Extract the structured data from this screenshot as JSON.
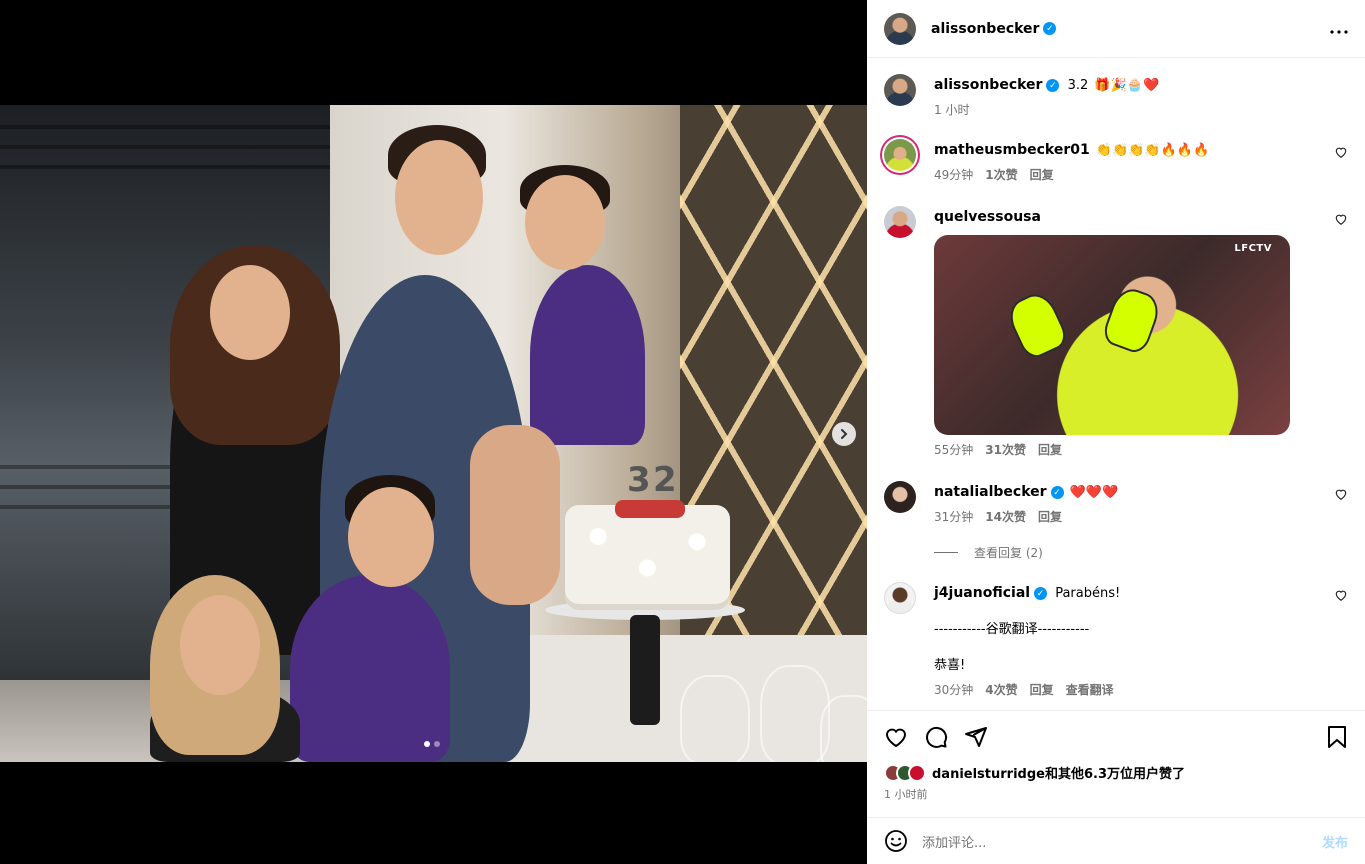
{
  "post": {
    "author": "alissonbecker",
    "more_icon": "more-horizontal-icon",
    "carousel": {
      "total": 2,
      "current": 1,
      "next_icon": "chevron-right-icon"
    }
  },
  "caption": {
    "username": "alissonbecker",
    "text": "3.2",
    "emojis": "🎁🎉🧁❤️",
    "time": "1 小时"
  },
  "comments": [
    {
      "username": "matheusmbecker01",
      "verified": false,
      "text": "",
      "emojis": "👏👏👏👏🔥🔥🔥",
      "time": "49分钟",
      "likes": "1次赞",
      "reply": "回复"
    },
    {
      "username": "quelvessousa",
      "verified": false,
      "text": "",
      "gif_tag": "LFCTV",
      "time": "55分钟",
      "likes": "31次赞",
      "reply": "回复"
    },
    {
      "username": "natalialbecker",
      "verified": true,
      "text": "",
      "emojis": "❤️❤️❤️",
      "time": "31分钟",
      "likes": "14次赞",
      "reply": "回复",
      "view_replies": "查看回复 (2)"
    },
    {
      "username": "j4juanoficial",
      "verified": true,
      "text": "Parabéns!",
      "translate_header": "-----------谷歌翻译-----------",
      "translation": "恭喜!",
      "time": "30分钟",
      "likes": "4次赞",
      "reply": "回复",
      "see_translation": "查看翻译"
    }
  ],
  "likes": {
    "text": "danielsturridge和其他6.3万位用户赞了",
    "time": "1 小时前"
  },
  "add_comment": {
    "placeholder": "添加评论...",
    "post": "发布"
  },
  "colors": {
    "verified": "#0095f6",
    "muted": "#737373",
    "post_button": "#b3dbff"
  }
}
